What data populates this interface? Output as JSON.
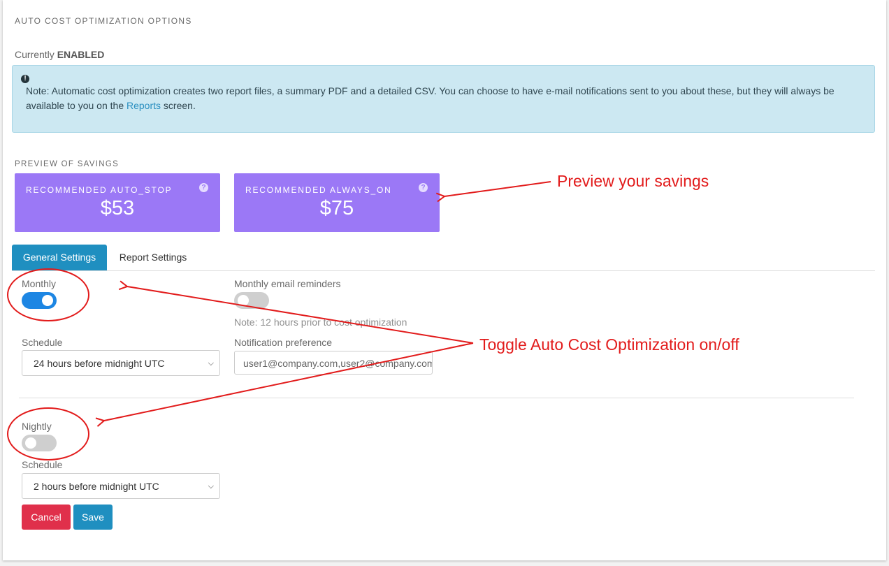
{
  "header": {
    "title": "AUTO COST OPTIMIZATION OPTIONS",
    "status_prefix": "Currently",
    "status_value": "ENABLED"
  },
  "note": {
    "icon": "exclamation-circle-icon",
    "text_before": "Note: Automatic cost optimization creates two report files, a summary PDF and a detailed CSV. You can choose to have e-mail notifications sent to you about these, but they will always be available to you on the",
    "link_text": "Reports",
    "text_after": "screen."
  },
  "preview": {
    "title": "PREVIEW OF SAVINGS",
    "cards": [
      {
        "label": "RECOMMENDED AUTO_STOP",
        "value": "$53",
        "help_icon": "question-circle-icon"
      },
      {
        "label": "RECOMMENDED ALWAYS_ON",
        "value": "$75",
        "help_icon": "question-circle-icon"
      }
    ]
  },
  "tabs": [
    {
      "label": "General Settings",
      "active": true
    },
    {
      "label": "Report Settings",
      "active": false
    }
  ],
  "monthly": {
    "label": "Monthly",
    "enabled": true,
    "schedule_label": "Schedule",
    "schedule_value": "24 hours before midnight UTC"
  },
  "reminders": {
    "label": "Monthly email reminders",
    "enabled": false,
    "note": "Note: 12 hours prior to cost optimization",
    "pref_label": "Notification preference",
    "pref_value": "user1@company.com,user2@company.com"
  },
  "nightly": {
    "label": "Nightly",
    "enabled": false,
    "schedule_label": "Schedule",
    "schedule_value": "2 hours before midnight UTC"
  },
  "actions": {
    "cancel": "Cancel",
    "save": "Save"
  },
  "annotations": {
    "preview": "Preview your savings",
    "toggle": "Toggle Auto Cost Optimization on/off",
    "color": "#e21b1b"
  },
  "colors": {
    "card": "#9b78f6",
    "primary": "#1f8fc0",
    "toggle_on": "#1d86e3",
    "cancel": "#e0304b",
    "note_bg": "#cce8f2"
  }
}
